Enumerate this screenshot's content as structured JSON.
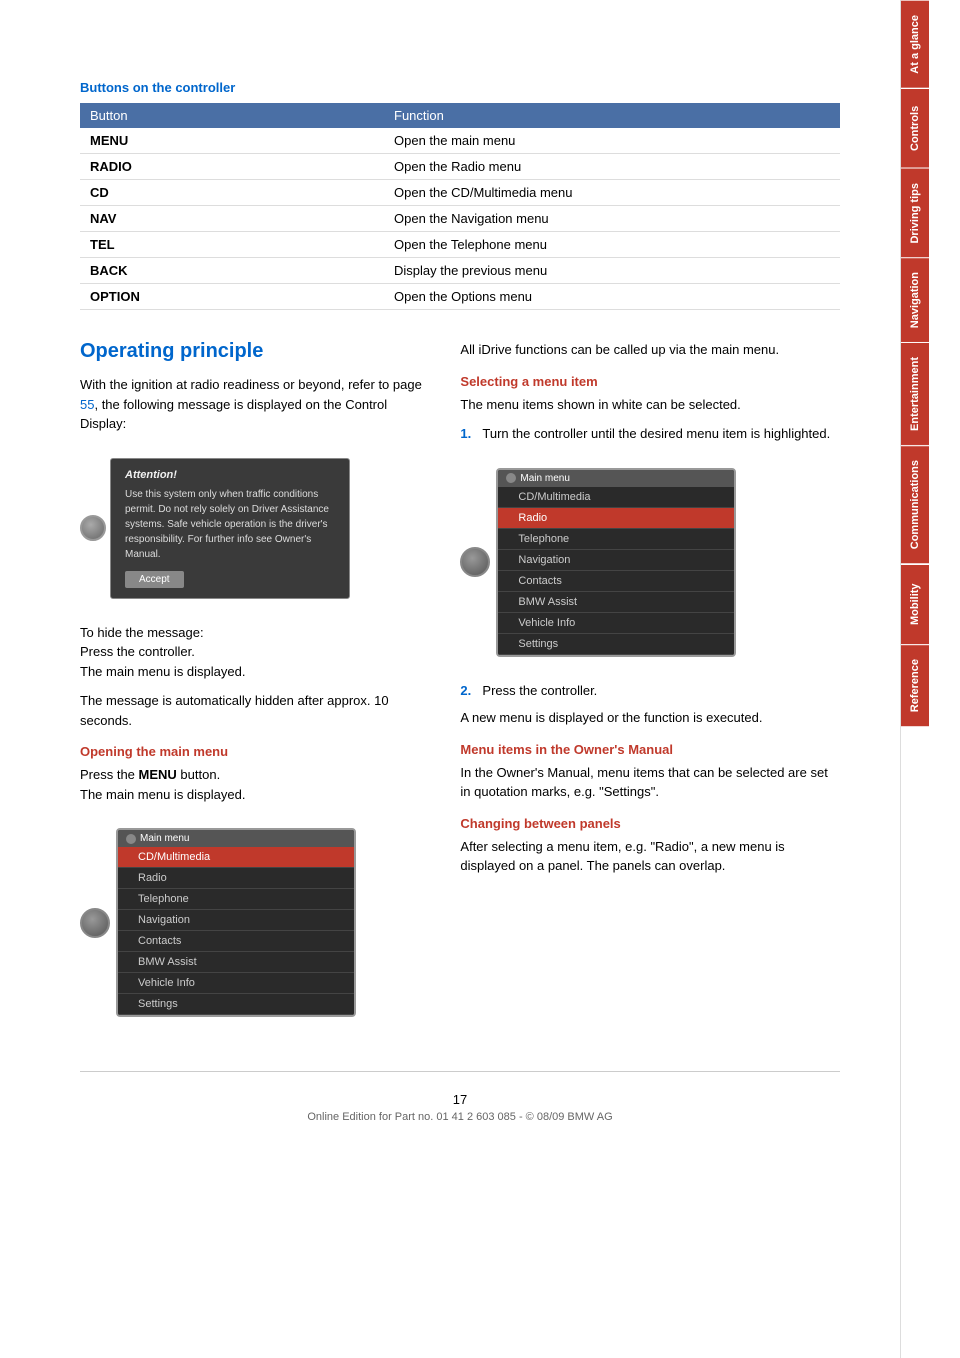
{
  "page": {
    "number": "17",
    "footer_text": "Online Edition for Part no. 01 41 2 603 085 - © 08/09 BMW AG"
  },
  "sidebar": {
    "tabs": [
      {
        "label": "At a glance",
        "active": false
      },
      {
        "label": "Controls",
        "active": false
      },
      {
        "label": "Driving tips",
        "active": false
      },
      {
        "label": "Navigation",
        "active": false
      },
      {
        "label": "Entertainment",
        "active": false
      },
      {
        "label": "Communications",
        "active": false
      },
      {
        "label": "Mobility",
        "active": false
      },
      {
        "label": "Reference",
        "active": false
      }
    ]
  },
  "buttons_section": {
    "title": "Buttons on the controller",
    "table": {
      "headers": [
        "Button",
        "Function"
      ],
      "rows": [
        {
          "button": "MENU",
          "function": "Open the main menu"
        },
        {
          "button": "RADIO",
          "function": "Open the Radio menu"
        },
        {
          "button": "CD",
          "function": "Open the CD/Multimedia menu"
        },
        {
          "button": "NAV",
          "function": "Open the Navigation menu"
        },
        {
          "button": "TEL",
          "function": "Open the Telephone menu"
        },
        {
          "button": "BACK",
          "function": "Display the previous menu"
        },
        {
          "button": "OPTION",
          "function": "Open the Options menu"
        }
      ]
    }
  },
  "operating_principle": {
    "heading": "Operating principle",
    "intro_text": "With the ignition at radio readiness or beyond, refer to page ",
    "intro_link": "55",
    "intro_text2": ", the following message is displayed on the Control Display:",
    "attention_title": "Attention!",
    "attention_body": "Use this system only when traffic conditions permit. Do not rely solely on Driver Assistance systems. Safe vehicle operation is the driver's responsibility. For further info see Owner's Manual.",
    "accept_label": "Accept",
    "hide_message_text": "To hide the message:\nPress the controller.\nThe main menu is displayed.",
    "auto_hidden_text": "The message is automatically hidden after approx. 10 seconds.",
    "opening_main_menu_title": "Opening the main menu",
    "opening_main_menu_text1": "Press the ",
    "opening_main_menu_bold": "MENU",
    "opening_main_menu_text2": " button.\nThe main menu is displayed.",
    "main_menu_label": "Main menu",
    "menu_items_left": [
      {
        "label": "CD/Multimedia",
        "highlighted": true
      },
      {
        "label": "Radio",
        "highlighted": false
      },
      {
        "label": "Telephone",
        "highlighted": false
      },
      {
        "label": "Navigation",
        "highlighted": false
      },
      {
        "label": "Contacts",
        "highlighted": false
      },
      {
        "label": "BMW Assist",
        "highlighted": false
      },
      {
        "label": "Vehicle Info",
        "highlighted": false
      },
      {
        "label": "Settings",
        "highlighted": false
      }
    ],
    "right_column": {
      "intro_text": "All iDrive functions can be called up via the main menu.",
      "selecting_title": "Selecting a menu item",
      "selecting_text": "The menu items shown in white can be selected.",
      "step1_text": "Turn the controller until the desired menu item is highlighted.",
      "menu_items_right": [
        {
          "label": "CD/Multimedia",
          "highlighted": false
        },
        {
          "label": "Radio",
          "highlighted": true
        },
        {
          "label": "Telephone",
          "highlighted": false
        },
        {
          "label": "Navigation",
          "highlighted": false
        },
        {
          "label": "Contacts",
          "highlighted": false
        },
        {
          "label": "BMW Assist",
          "highlighted": false
        },
        {
          "label": "Vehicle Info",
          "highlighted": false
        },
        {
          "label": "Settings",
          "highlighted": false
        }
      ],
      "step2_text": "Press the controller.",
      "new_menu_text": "A new menu is displayed or the function is executed.",
      "owners_manual_title": "Menu items in the Owner's Manual",
      "owners_manual_text": "In the Owner's Manual, menu items that can be selected are set in quotation marks, e.g. \"Settings\".",
      "changing_panels_title": "Changing between panels",
      "changing_panels_text": "After selecting a menu item, e.g. \"Radio\", a new menu is displayed on a panel. The panels can overlap."
    }
  }
}
